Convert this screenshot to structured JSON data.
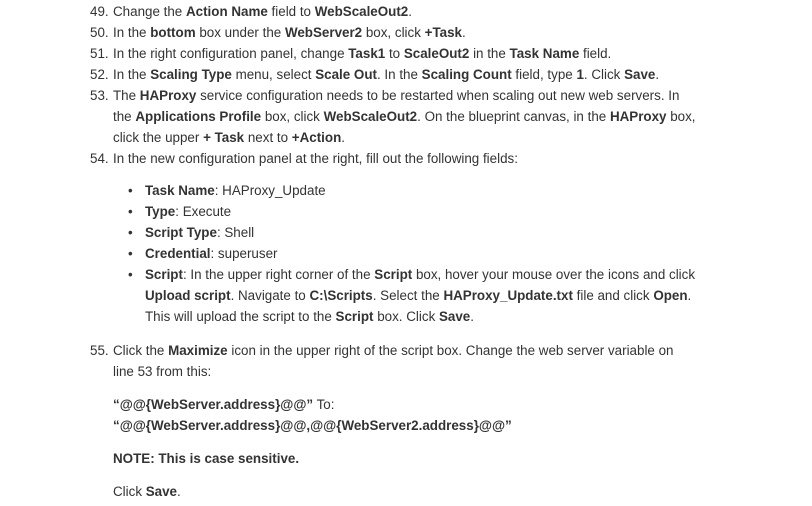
{
  "steps": [
    {
      "num": "49.",
      "lines": [
        [
          {
            "t": "Change the "
          },
          {
            "t": "Action Name",
            "b": true
          },
          {
            "t": " field to "
          },
          {
            "t": "WebScaleOut2",
            "b": true
          },
          {
            "t": "."
          }
        ]
      ]
    },
    {
      "num": "50.",
      "lines": [
        [
          {
            "t": "In the "
          },
          {
            "t": "bottom",
            "b": true
          },
          {
            "t": " box under the "
          },
          {
            "t": "WebServer2",
            "b": true
          },
          {
            "t": " box, click "
          },
          {
            "t": "+Task",
            "b": true
          },
          {
            "t": "."
          }
        ]
      ]
    },
    {
      "num": "51.",
      "lines": [
        [
          {
            "t": "In the right configuration panel, change "
          },
          {
            "t": "Task1",
            "b": true
          },
          {
            "t": " to "
          },
          {
            "t": "ScaleOut2",
            "b": true
          },
          {
            "t": " in the "
          },
          {
            "t": "Task Name",
            "b": true
          },
          {
            "t": " field."
          }
        ]
      ]
    },
    {
      "num": "52.",
      "lines": [
        [
          {
            "t": "In the "
          },
          {
            "t": "Scaling Type",
            "b": true
          },
          {
            "t": " menu, select "
          },
          {
            "t": "Scale Out",
            "b": true
          },
          {
            "t": ". In the "
          },
          {
            "t": "Scaling Count",
            "b": true
          },
          {
            "t": " field, type "
          },
          {
            "t": "1",
            "b": true
          },
          {
            "t": ". Click "
          },
          {
            "t": "Save",
            "b": true
          },
          {
            "t": "."
          }
        ]
      ]
    },
    {
      "num": "53.",
      "lines": [
        [
          {
            "t": "The "
          },
          {
            "t": "HAProxy",
            "b": true
          },
          {
            "t": " service configuration needs to be restarted when scaling out new web servers. In"
          }
        ],
        [
          {
            "t": "the "
          },
          {
            "t": "Applications Profile",
            "b": true
          },
          {
            "t": " box, click "
          },
          {
            "t": "WebScaleOut2",
            "b": true
          },
          {
            "t": ". On the blueprint canvas, in the "
          },
          {
            "t": "HAProxy",
            "b": true
          },
          {
            "t": " box,"
          }
        ],
        [
          {
            "t": "click the upper "
          },
          {
            "t": "+ Task",
            "b": true
          },
          {
            "t": " next to "
          },
          {
            "t": "+Action",
            "b": true
          },
          {
            "t": "."
          }
        ]
      ]
    },
    {
      "num": "54.",
      "lines": [
        [
          {
            "t": "In the new configuration panel at the right, fill out the following fields:"
          }
        ]
      ]
    }
  ],
  "bullets": [
    {
      "lines": [
        [
          {
            "t": "Task Name",
            "b": true
          },
          {
            "t": ": HAProxy_Update"
          }
        ]
      ]
    },
    {
      "lines": [
        [
          {
            "t": "Type",
            "b": true
          },
          {
            "t": ": Execute"
          }
        ]
      ]
    },
    {
      "lines": [
        [
          {
            "t": "Script Type",
            "b": true
          },
          {
            "t": ": Shell"
          }
        ]
      ]
    },
    {
      "lines": [
        [
          {
            "t": "Credential",
            "b": true
          },
          {
            "t": ": superuser"
          }
        ]
      ]
    },
    {
      "lines": [
        [
          {
            "t": "Script",
            "b": true
          },
          {
            "t": ": In the upper right corner of the "
          },
          {
            "t": "Script",
            "b": true
          },
          {
            "t": " box, hover your mouse over the icons and click"
          }
        ],
        [
          {
            "t": "Upload script",
            "b": true
          },
          {
            "t": ". Navigate to "
          },
          {
            "t": "C:\\Scripts",
            "b": true
          },
          {
            "t": ". Select the "
          },
          {
            "t": "HAProxy_Update.txt",
            "b": true
          },
          {
            "t": " file and click "
          },
          {
            "t": "Open",
            "b": true
          },
          {
            "t": "."
          }
        ],
        [
          {
            "t": "This will upload the script to the "
          },
          {
            "t": "Script",
            "b": true
          },
          {
            "t": " box. Click "
          },
          {
            "t": "Save",
            "b": true
          },
          {
            "t": "."
          }
        ]
      ]
    }
  ],
  "step55": {
    "num": "55.",
    "lines": [
      [
        {
          "t": "Click the "
        },
        {
          "t": "Maximize",
          "b": true
        },
        {
          "t": " icon in the upper right of the script box. Change the web server variable on"
        }
      ],
      [
        {
          "t": "line 53 from this:"
        }
      ]
    ]
  },
  "code_lines": [
    [
      {
        "t": "“@@{WebServer.address}@@”",
        "b": true
      },
      {
        "t": " To:"
      }
    ],
    [
      {
        "t": "“@@{WebServer.address}@@,@@{WebServer2.address}@@”",
        "b": true
      }
    ]
  ],
  "note": "NOTE: This is case sensitive.",
  "final_line": [
    {
      "t": "Click "
    },
    {
      "t": "Save",
      "b": true
    },
    {
      "t": "."
    }
  ],
  "bullet_glyph": "•"
}
